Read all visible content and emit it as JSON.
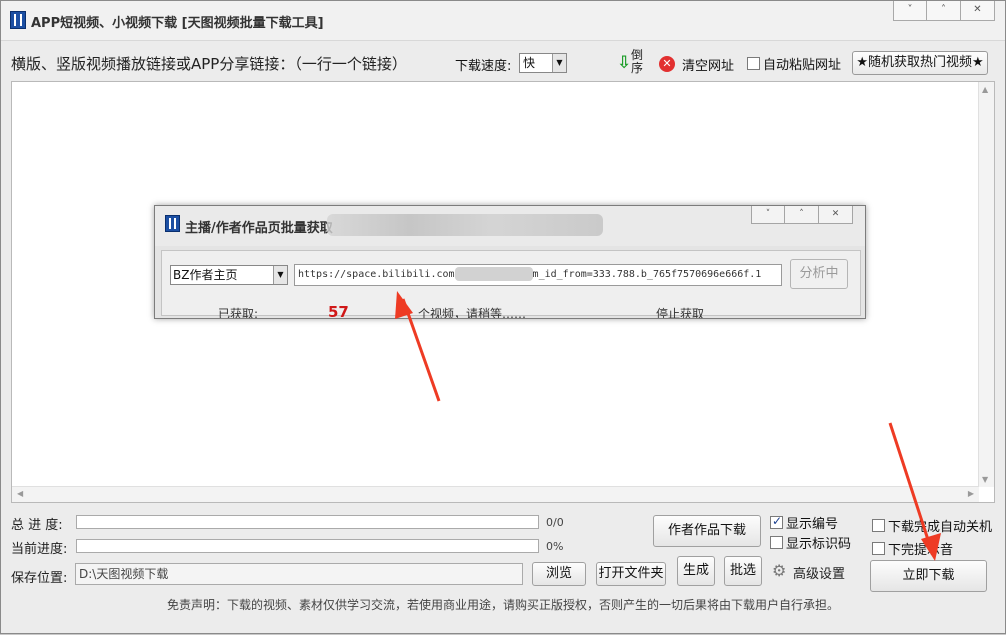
{
  "app": {
    "title": "APP短视频、小视频下载 [天图视频批量下载工具]",
    "window_controls": [
      "˅",
      "˄",
      "✕"
    ]
  },
  "toolbar": {
    "link_label": "横版、竖版视频播放链接或APP分享链接：（一行一个链接）",
    "speed_label": "下载速度:",
    "speed_value": "快",
    "sort_label": "倒序",
    "clear_label": "清空网址",
    "autopaste_label": "自动粘贴网址",
    "autopaste_checked": false,
    "hot_button": "★随机获取热门视频★"
  },
  "dialog": {
    "title": "主播/作者作品页批量获取",
    "window_controls": [
      "˅",
      "˄",
      "✕"
    ],
    "source_select": "BZ作者主页",
    "url_prefix": "https://space.bilibili.com",
    "url_suffix": "m_id_from=333.788.b_765f7570696e666f.1",
    "analyze_button": "分析中",
    "stat_fetched_label": "已获取:",
    "stat_count": "57",
    "stat_progress_text": "个视频，请稍等……",
    "stop_label": "停止获取"
  },
  "progress": {
    "total_label": "总 进 度:",
    "total_value": "0/0",
    "total_fraction": 0,
    "current_label": "当前进度:",
    "current_value": "0%",
    "current_fraction": 0
  },
  "save": {
    "label": "保存位置:",
    "path": "D:\\天图视频下载",
    "browse_button": "浏览",
    "open_folder_button": "打开文件夹"
  },
  "actions": {
    "author_download": "作者作品下载",
    "show_number": "显示编号",
    "show_number_checked": true,
    "show_id": "显示标识码",
    "show_id_checked": false,
    "generate": "生成",
    "pick": "批选",
    "advanced": "高级设置",
    "shutdown_label": "下载完成自动关机",
    "shutdown_checked": false,
    "sound_label": "下完提示音",
    "sound_checked": false,
    "download_now": "立即下载"
  },
  "disclaimer": "免责声明：下载的视频、素材仅供学习交流，若使用商业用途，请购买正版授权，否则产生的一切后果将由下载用户自行承担。",
  "colors": {
    "annotation_arrow": "#ee3b24",
    "count_red": "#d01818"
  }
}
